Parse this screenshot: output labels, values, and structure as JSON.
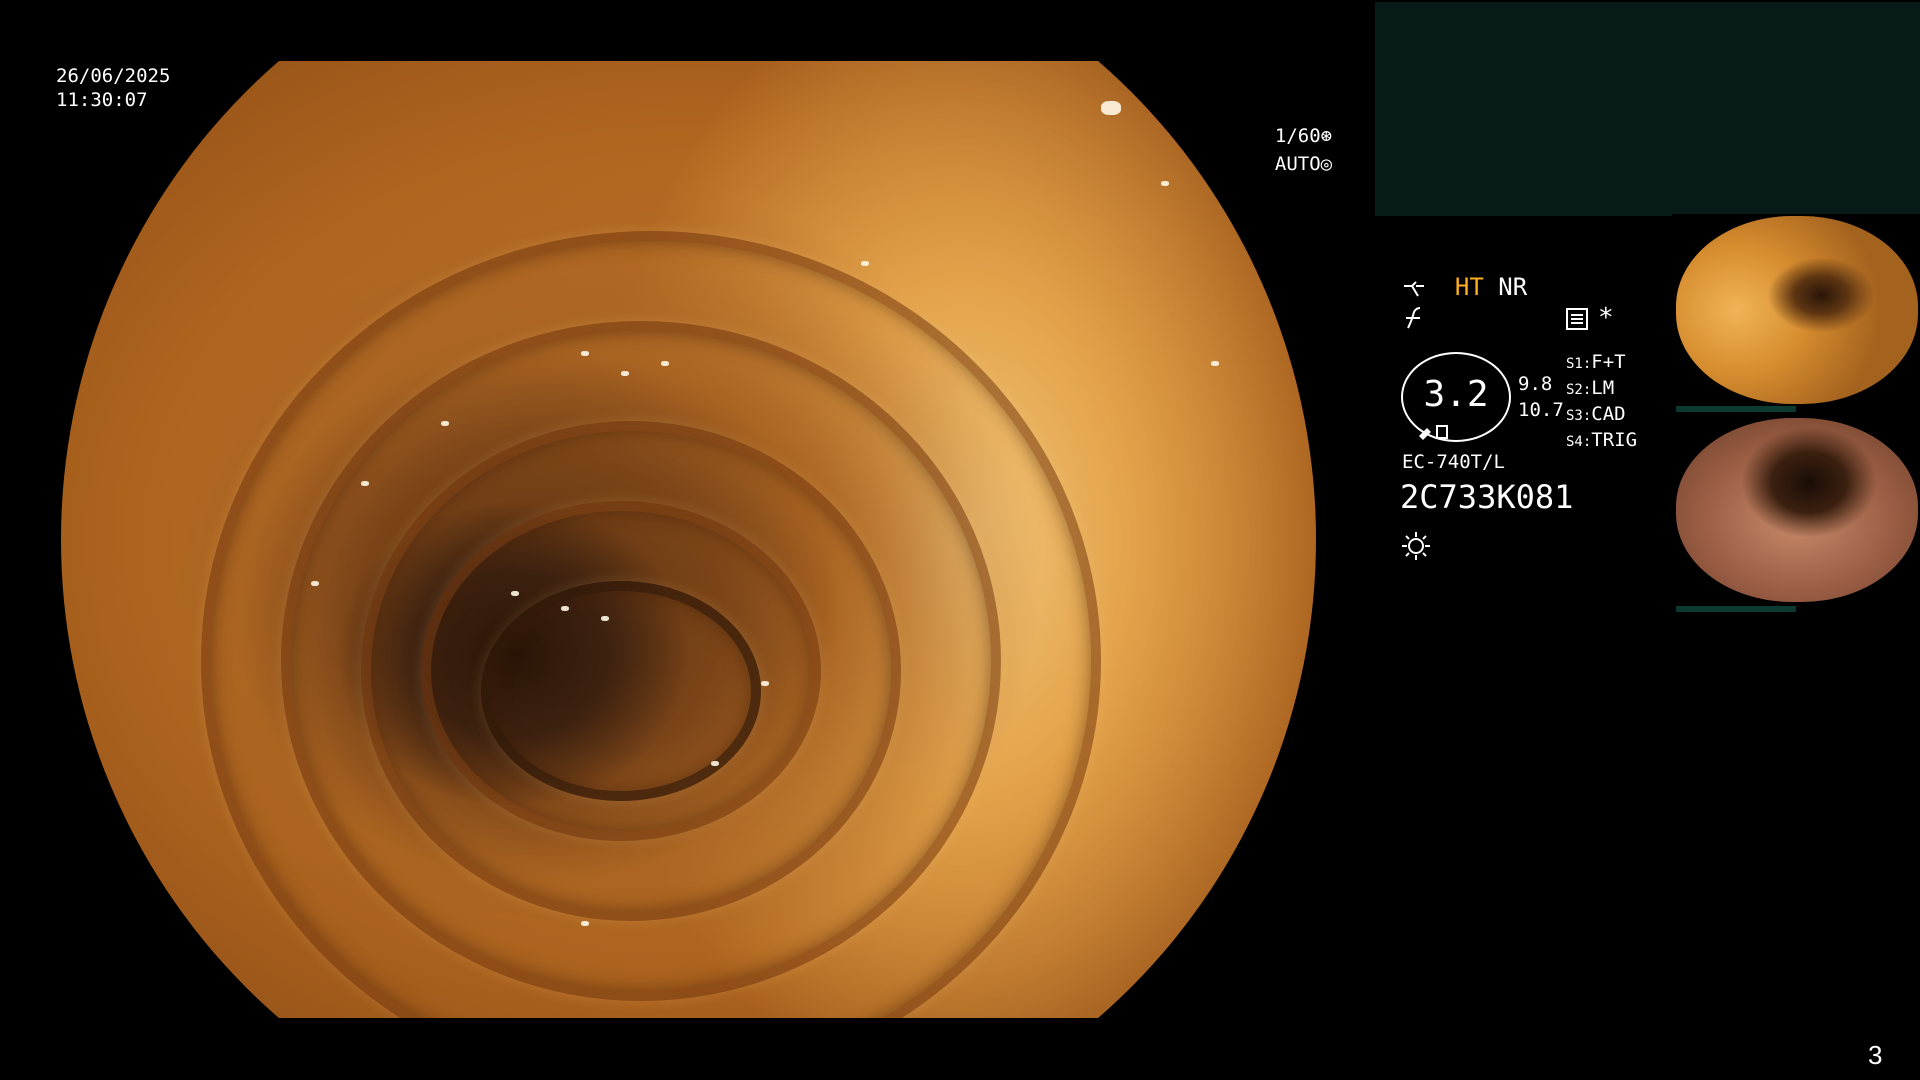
{
  "overlay": {
    "date": "26/06/2025",
    "time": "11:30:07",
    "shutter": "1/60",
    "iris": "AUTO",
    "page_number": "3"
  },
  "settings": {
    "ht_label": "HT",
    "nr_label": "NR",
    "gauge_value": "3.2",
    "side_top": "9.8",
    "side_bottom": "10.7",
    "star": "*",
    "switches": [
      {
        "key": "S1",
        "value": "F+T"
      },
      {
        "key": "S2",
        "value": "LM"
      },
      {
        "key": "S3",
        "value": "CAD"
      },
      {
        "key": "S4",
        "value": "TRIG"
      }
    ],
    "scope_model": "EC-740T/L",
    "serial": "2C733K081"
  },
  "colors": {
    "ht_accent": "#ffb020",
    "panel_bg": "#061a17"
  },
  "icons": [
    "shutter-icon",
    "iris-icon",
    "filter-icon",
    "function-icon",
    "record-icon",
    "light-icon"
  ]
}
